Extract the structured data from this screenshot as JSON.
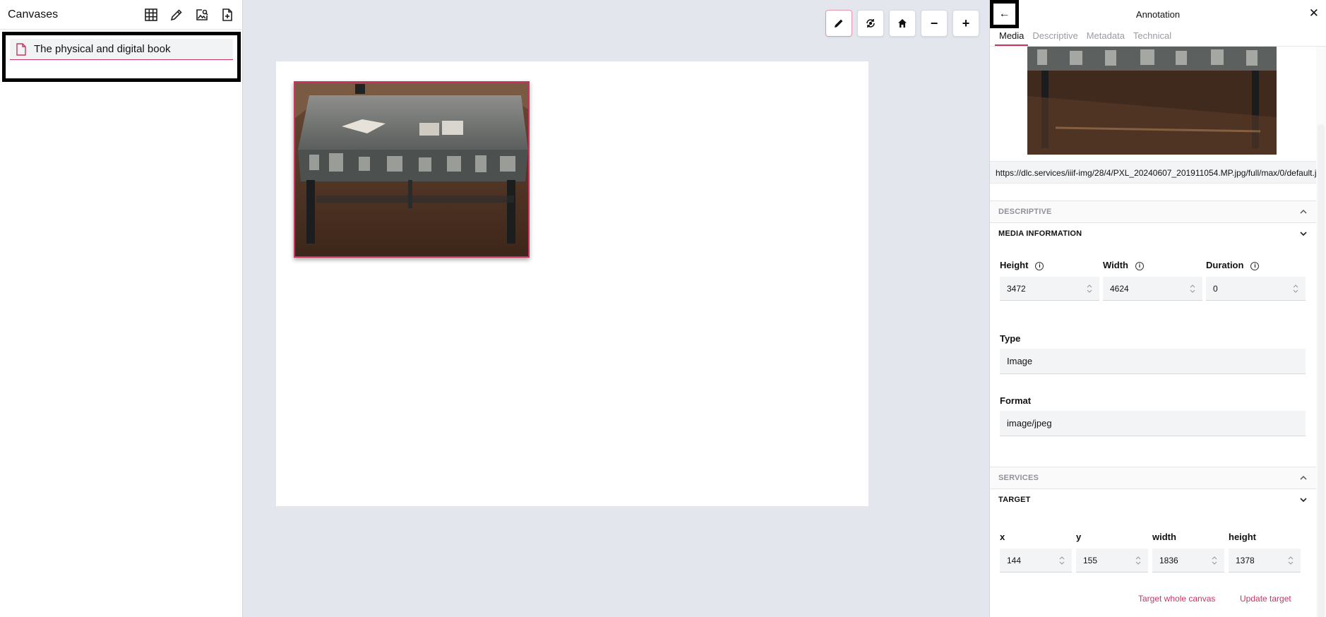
{
  "sidebar": {
    "title": "Canvases",
    "icons": [
      "grid-icon",
      "pencil-icon",
      "image-search-icon",
      "add-file-icon"
    ],
    "items": [
      {
        "label": "The physical and digital book"
      }
    ]
  },
  "toolbar": {
    "buttons": [
      "pencil-icon",
      "rotate-icon",
      "home-icon",
      "zoom-out-icon",
      "zoom-in-icon"
    ],
    "zoom_out_label": "−",
    "zoom_in_label": "+"
  },
  "panel": {
    "back_label": "←",
    "title": "Annotation",
    "close_label": "✕",
    "tabs": [
      {
        "label": "Media",
        "active": true
      },
      {
        "label": "Descriptive"
      },
      {
        "label": "Metadata"
      },
      {
        "label": "Technical"
      }
    ],
    "url": "https://dlc.services/iiif-img/28/4/PXL_20240607_201911054.MP.jpg/full/max/0/default.jpg",
    "sections": {
      "descriptive": "DESCRIPTIVE",
      "media_information": "MEDIA INFORMATION",
      "services": "SERVICES",
      "target": "TARGET"
    },
    "media_info": {
      "height_label": "Height",
      "height_value": "3472",
      "width_label": "Width",
      "width_value": "4624",
      "duration_label": "Duration",
      "duration_value": "0",
      "info_glyph": "i",
      "type_label": "Type",
      "type_value": "Image",
      "format_label": "Format",
      "format_value": "image/jpeg"
    },
    "target": {
      "x_label": "x",
      "x_value": "144",
      "y_label": "y",
      "y_value": "155",
      "width_label": "width",
      "width_value": "1836",
      "height_label": "height",
      "height_value": "1378",
      "target_whole_canvas": "Target whole canvas",
      "update_target": "Update target"
    }
  },
  "colors": {
    "accent": "#c7365f",
    "workspace_bg": "#e4e6ee"
  }
}
